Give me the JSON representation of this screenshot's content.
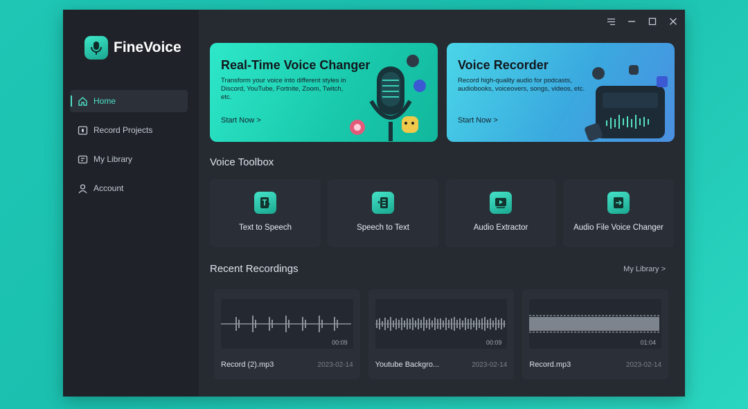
{
  "app": {
    "name": "FineVoice"
  },
  "sidebar": {
    "items": [
      {
        "label": "Home",
        "icon": "home-icon",
        "active": true
      },
      {
        "label": "Record Projects",
        "icon": "record-icon"
      },
      {
        "label": "My Library",
        "icon": "library-icon"
      },
      {
        "label": "Account",
        "icon": "user-icon"
      }
    ]
  },
  "window_controls": [
    "menu-icon",
    "minimize-icon",
    "maximize-icon",
    "close-icon"
  ],
  "banners": [
    {
      "title": "Real-Time Voice Changer",
      "description": "Transform your voice into different styles in Discord, YouTube, Fortnite, Zoom, Twitch, etc.",
      "cta": "Start Now >"
    },
    {
      "title": "Voice Recorder",
      "description": "Record high-quality audio for podcasts, audiobooks, voiceovers, songs, videos, etc.",
      "cta": "Start Now >"
    }
  ],
  "toolbox": {
    "title": "Voice Toolbox",
    "tools": [
      {
        "label": "Text to Speech",
        "icon": "text-to-speech-icon"
      },
      {
        "label": "Speech to Text",
        "icon": "speech-to-text-icon"
      },
      {
        "label": "Audio Extractor",
        "icon": "audio-extractor-icon"
      },
      {
        "label": "Audio File Voice Changer",
        "icon": "audio-file-voice-changer-icon"
      }
    ]
  },
  "recent": {
    "title": "Recent Recordings",
    "link": "My Library >",
    "items": [
      {
        "name": "Record (2).mp3",
        "date": "2023-02-14",
        "duration": "00:09"
      },
      {
        "name": "Youtube Backgro...",
        "date": "2023-02-14",
        "duration": "00:09"
      },
      {
        "name": "Record.mp3",
        "date": "2023-02-14",
        "duration": "01:04"
      }
    ]
  },
  "colors": {
    "accent": "#4ee0c7",
    "window_bg": "#262a31",
    "sidebar_bg": "#1f2329",
    "page_bg": "#1fc6b4"
  }
}
